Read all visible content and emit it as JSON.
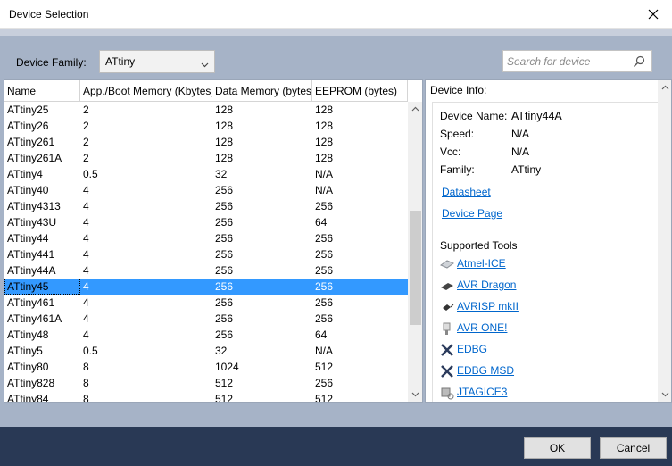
{
  "window": {
    "title": "Device Selection"
  },
  "family": {
    "label": "Device Family:",
    "selected": "ATtiny"
  },
  "search": {
    "placeholder": "Search for device"
  },
  "grid": {
    "columns": [
      "Name",
      "App./Boot Memory (Kbytes)",
      "Data Memory (bytes)",
      "EEPROM (bytes)"
    ],
    "selected_index": 11,
    "rows": [
      [
        "ATtiny25",
        "2",
        "128",
        "128"
      ],
      [
        "ATtiny26",
        "2",
        "128",
        "128"
      ],
      [
        "ATtiny261",
        "2",
        "128",
        "128"
      ],
      [
        "ATtiny261A",
        "2",
        "128",
        "128"
      ],
      [
        "ATtiny4",
        "0.5",
        "32",
        "N/A"
      ],
      [
        "ATtiny40",
        "4",
        "256",
        "N/A"
      ],
      [
        "ATtiny4313",
        "4",
        "256",
        "256"
      ],
      [
        "ATtiny43U",
        "4",
        "256",
        "64"
      ],
      [
        "ATtiny44",
        "4",
        "256",
        "256"
      ],
      [
        "ATtiny441",
        "4",
        "256",
        "256"
      ],
      [
        "ATtiny44A",
        "4",
        "256",
        "256"
      ],
      [
        "ATtiny45",
        "4",
        "256",
        "256"
      ],
      [
        "ATtiny461",
        "4",
        "256",
        "256"
      ],
      [
        "ATtiny461A",
        "4",
        "256",
        "256"
      ],
      [
        "ATtiny48",
        "4",
        "256",
        "64"
      ],
      [
        "ATtiny5",
        "0.5",
        "32",
        "N/A"
      ],
      [
        "ATtiny80",
        "8",
        "1024",
        "512"
      ],
      [
        "ATtiny828",
        "8",
        "512",
        "256"
      ],
      [
        "ATtiny84",
        "8",
        "512",
        "512"
      ]
    ]
  },
  "info": {
    "label": "Device Info:",
    "device_name_label": "Device Name:",
    "device_name": "ATtiny44A",
    "speed_label": "Speed:",
    "speed": "N/A",
    "vcc_label": "Vcc:",
    "vcc": "N/A",
    "family_label": "Family:",
    "family": "ATtiny",
    "datasheet": "Datasheet",
    "device_page": "Device Page",
    "supported_tools_label": "Supported Tools",
    "tools": [
      {
        "name": "Atmel-ICE",
        "icon": "atmel-ice-icon"
      },
      {
        "name": "AVR Dragon",
        "icon": "avr-dragon-icon"
      },
      {
        "name": "AVRISP mkII",
        "icon": "avrisp-icon"
      },
      {
        "name": "AVR ONE!",
        "icon": "avr-one-icon"
      },
      {
        "name": "EDBG",
        "icon": "edbg-icon"
      },
      {
        "name": "EDBG MSD",
        "icon": "edbg-icon"
      },
      {
        "name": "JTAGICE3",
        "icon": "jtagice3-icon"
      }
    ]
  },
  "buttons": {
    "ok": "OK",
    "cancel": "Cancel"
  },
  "colors": {
    "selection": "#3399ff",
    "footer": "#293955",
    "client": "#a6b3c7",
    "link": "#0066cc"
  }
}
